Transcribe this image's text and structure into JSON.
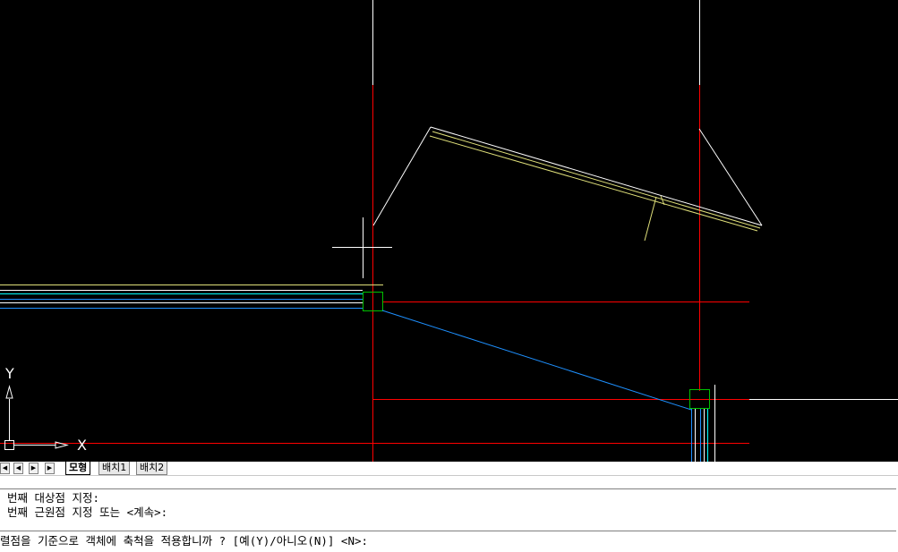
{
  "layout_tabs": {
    "nav_buttons": [
      "first",
      "previous",
      "next",
      "last"
    ],
    "tabs": [
      {
        "label": "모형",
        "active": true
      },
      {
        "label": "배치1",
        "active": false
      },
      {
        "label": "배치2",
        "active": false
      }
    ]
  },
  "ucs": {
    "x_label": "X",
    "y_label": "Y"
  },
  "command": {
    "history": [
      "번째 대상점 지정:",
      "번째 근원점 지정 또는 <계속>:"
    ],
    "prompt": "렬점을 기준으로 객체에 축척을 적용합니까 ? [예(Y)/아니오(N)] <N>:"
  },
  "colors": {
    "background": "#000000",
    "red_layer": "#ff0000",
    "yellow_layer": "#e0e07a",
    "white_layer": "#ffffff",
    "blue_layer": "#1e90ff",
    "green_layer": "#00c000",
    "cyan_layer": "#00ffff"
  }
}
